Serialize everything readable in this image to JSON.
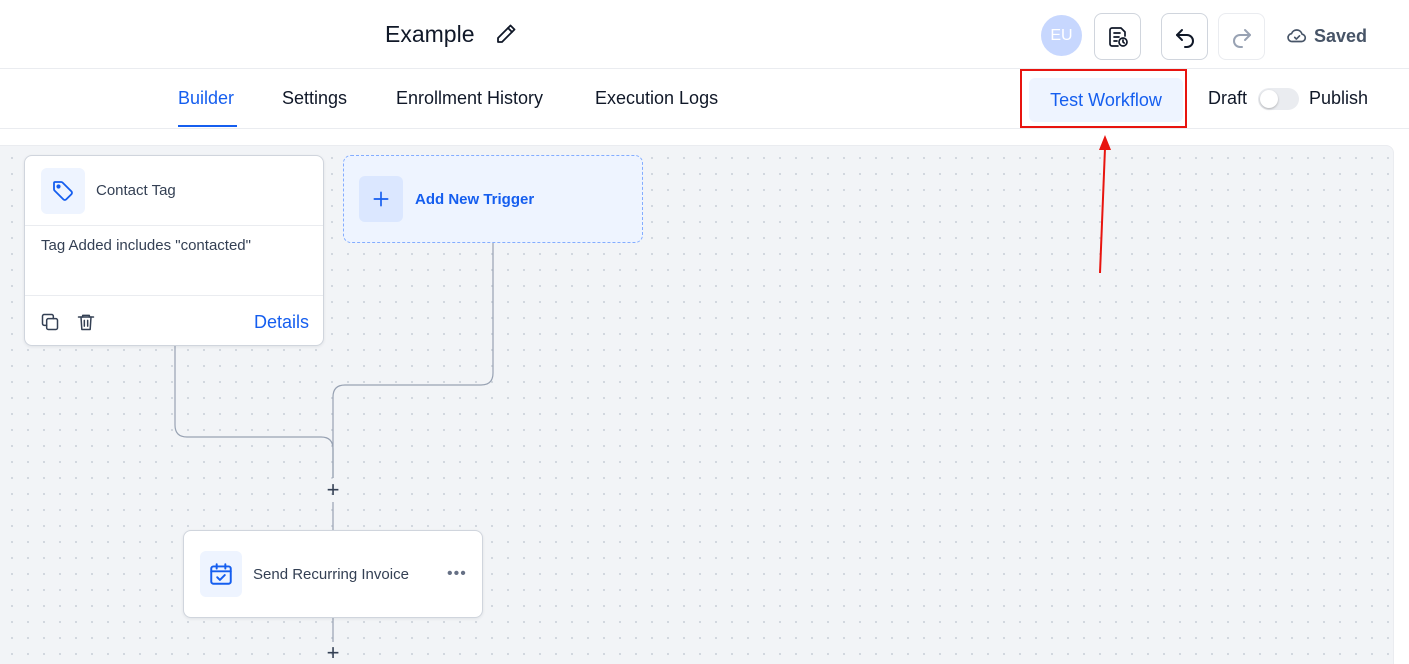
{
  "header": {
    "title": "Example",
    "edit_icon": "pencil-icon",
    "avatar_initials": "EU",
    "status_label": "Saved"
  },
  "tabs": {
    "builder": "Builder",
    "settings": "Settings",
    "enrollment_history": "Enrollment History",
    "execution_logs": "Execution Logs",
    "active": "Builder"
  },
  "actions": {
    "test_workflow": "Test Workflow",
    "draft_label": "Draft",
    "publish_label": "Publish",
    "publish_toggle_on": false
  },
  "trigger": {
    "name": "Contact Tag",
    "condition": "Tag Added includes \"contacted\"",
    "details_label": "Details"
  },
  "add_trigger": {
    "label": "Add New Trigger"
  },
  "action_step": {
    "name": "Send Recurring Invoice"
  },
  "colors": {
    "accent": "#155eef",
    "highlight": "#e8140f",
    "canvas": "#f2f4f7"
  }
}
